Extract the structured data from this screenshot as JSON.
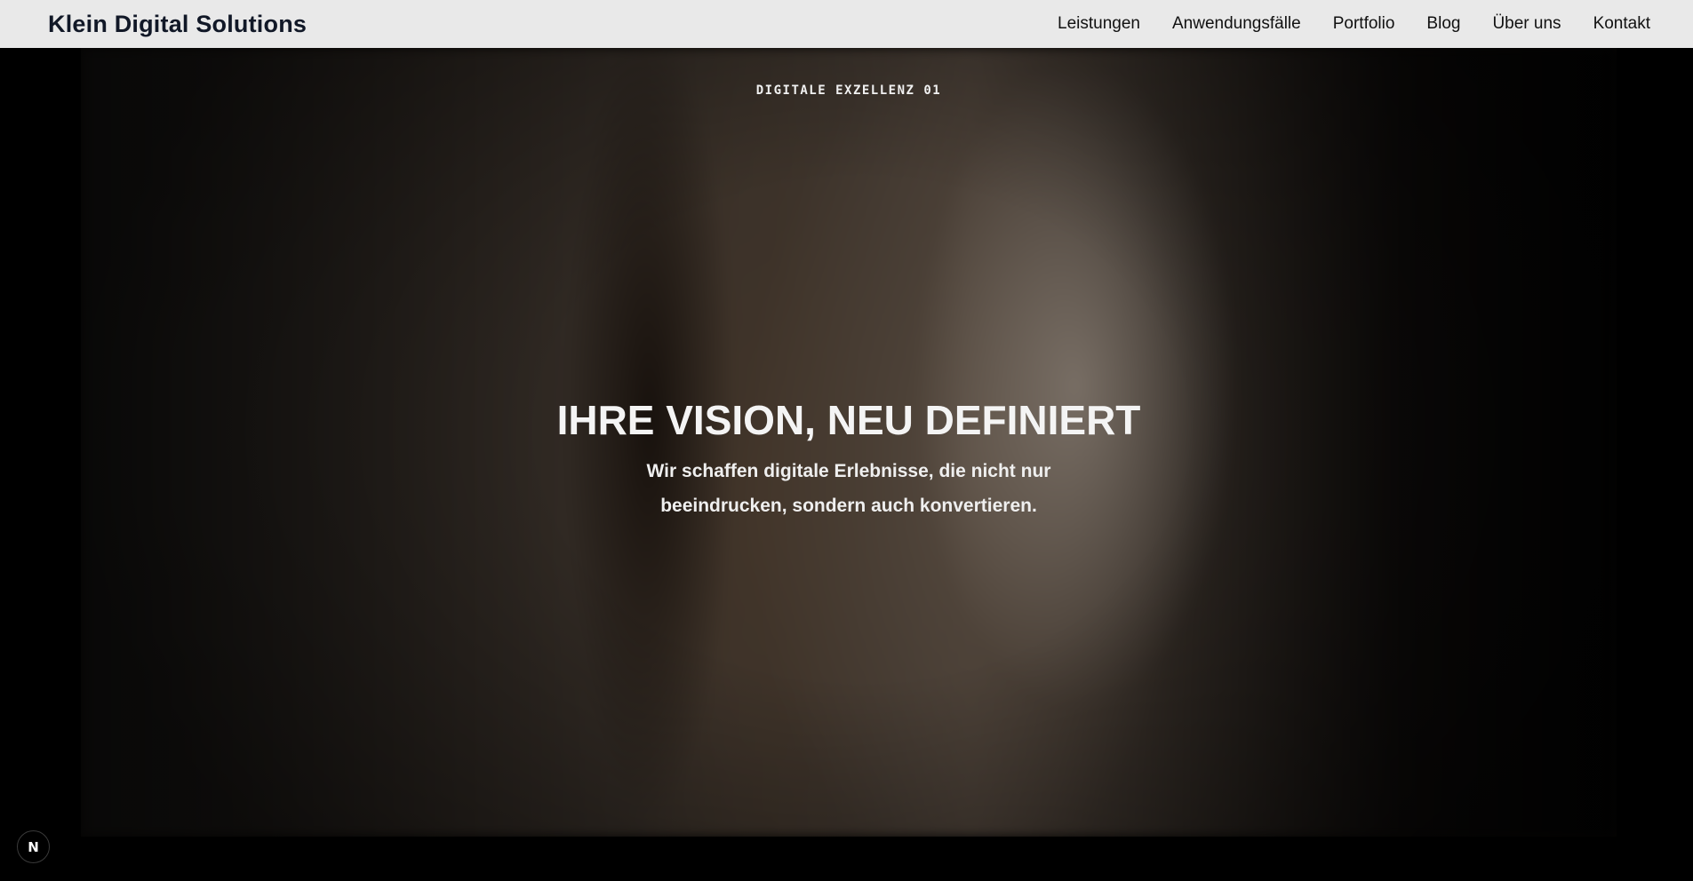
{
  "header": {
    "brand": "Klein Digital Solutions",
    "nav": [
      {
        "label": "Leistungen"
      },
      {
        "label": "Anwendungsfälle"
      },
      {
        "label": "Portfolio"
      },
      {
        "label": "Blog"
      },
      {
        "label": "Über uns"
      },
      {
        "label": "Kontakt"
      }
    ]
  },
  "hero": {
    "eyebrow": "DIGITALE EXZELLENZ 01",
    "headline": "IHRE VISION, NEU DEFINIERT",
    "subline_1": "Wir schaffen digitale Erlebnisse, die nicht nur",
    "subline_2": "beeindrucken, sondern auch konvertieren."
  },
  "badge": {
    "glyph": "N",
    "icon": "nextjs-icon"
  },
  "colors": {
    "header_bg": "#e9e9e9",
    "page_bg": "#000000",
    "text_light": "#f4f4f4",
    "text_dark": "#111827"
  }
}
